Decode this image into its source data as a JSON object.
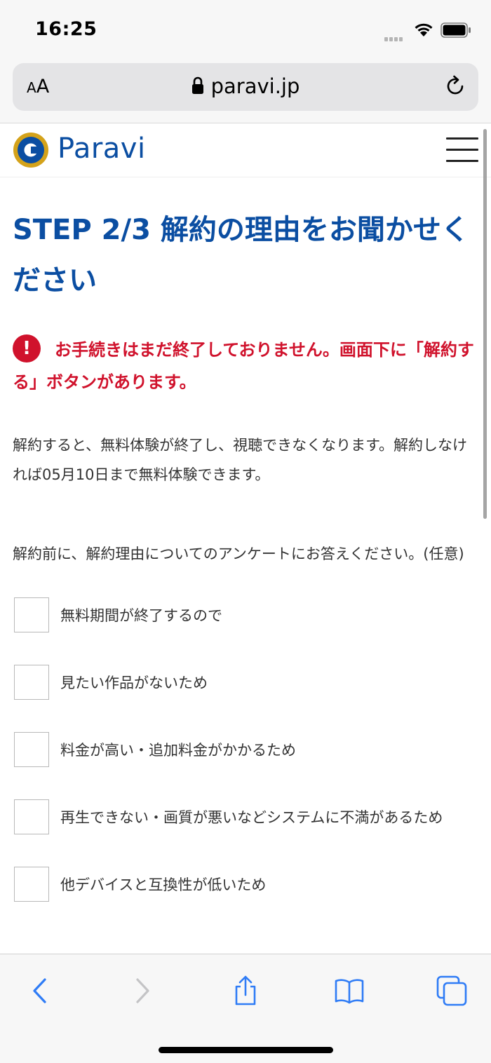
{
  "status_bar": {
    "time": "16:25"
  },
  "url_bar": {
    "text_size_small": "A",
    "text_size_large": "A",
    "domain": "paravi.jp"
  },
  "site_header": {
    "logo_text": "Paravi"
  },
  "page": {
    "title": "STEP 2/3 解約の理由をお聞かせください",
    "notice_icon": "!",
    "notice": "お手続きはまだ終了しておりません。画面下に「解約する」ボタンがあります。",
    "body_text": "解約すると、無料体験が終了し、視聴できなくなります。解約しなければ05月10日まで無料体験できます。",
    "survey_intro": "解約前に、解約理由についてのアンケートにお答えください。(任意)"
  },
  "survey_options": [
    {
      "label": "無料期間が終了するので",
      "checked": false
    },
    {
      "label": "見たい作品がないため",
      "checked": false
    },
    {
      "label": "料金が高い・追加料金がかかるため",
      "checked": false
    },
    {
      "label": "再生できない・画質が悪いなどシステムに不満があるため",
      "checked": false
    },
    {
      "label": "他デバイスと互換性が低いため",
      "checked": false
    }
  ],
  "colors": {
    "brand_blue": "#0b4ea2",
    "alert_red": "#d0122c",
    "ios_blue": "#2f7cf6",
    "logo_gold": "#d4a21a"
  },
  "toolbar_icons": [
    "back-icon",
    "forward-icon",
    "share-icon",
    "bookmarks-icon",
    "tabs-icon"
  ]
}
